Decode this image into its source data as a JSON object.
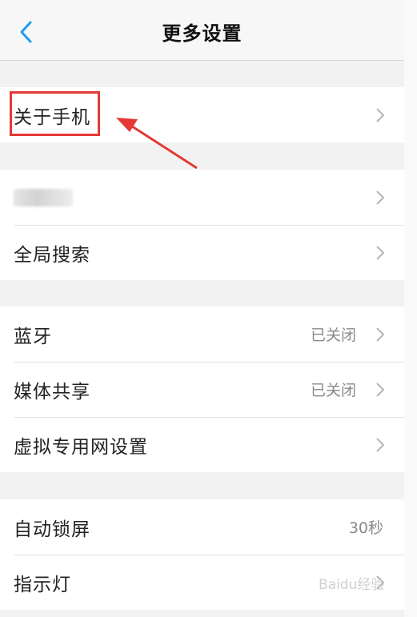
{
  "header": {
    "title": "更多设置",
    "back_icon": "chevron-left-icon",
    "accent": "#1e9bf0"
  },
  "groups": [
    {
      "rows": [
        {
          "label": "关于手机",
          "value": "",
          "chevron": true
        }
      ]
    },
    {
      "rows": [
        {
          "label": "",
          "value": "",
          "chevron": true,
          "blurred": true
        },
        {
          "label": "全局搜索",
          "value": "",
          "chevron": true
        }
      ]
    },
    {
      "rows": [
        {
          "label": "蓝牙",
          "value": "已关闭",
          "chevron": true
        },
        {
          "label": "媒体共享",
          "value": "已关闭",
          "chevron": true
        },
        {
          "label": "虚拟专用网设置",
          "value": "",
          "chevron": true
        }
      ]
    },
    {
      "rows": [
        {
          "label": "自动锁屏",
          "value": "30秒",
          "chevron": false
        },
        {
          "label": "指示灯",
          "value": "",
          "chevron": true
        }
      ]
    }
  ],
  "annotation": {
    "color": "#e53935"
  },
  "watermark": {
    "text": "Baidu经验"
  }
}
